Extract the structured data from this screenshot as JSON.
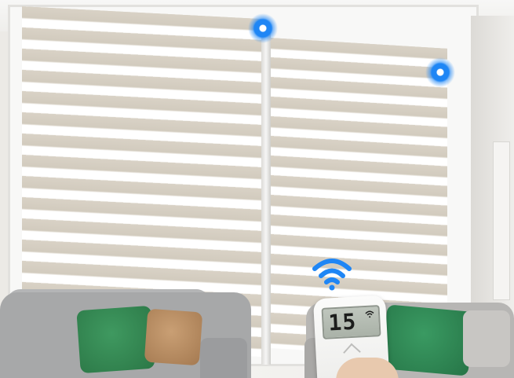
{
  "scene": {
    "description_colors": {
      "blind_fabric": "#d9d2c6",
      "sheer": "#ffffff",
      "indicator_blue": "#1f86f5",
      "pillow_green": "#3a9a62",
      "pillow_tan": "#c99f74",
      "sofa_grey": "#a7a8a9"
    }
  },
  "remote": {
    "display_value": "15",
    "signal_icon": "wifi-icon"
  },
  "indicators": {
    "icon": "signal-dot-icon"
  },
  "wifi_signal": {
    "icon": "wifi-icon"
  }
}
